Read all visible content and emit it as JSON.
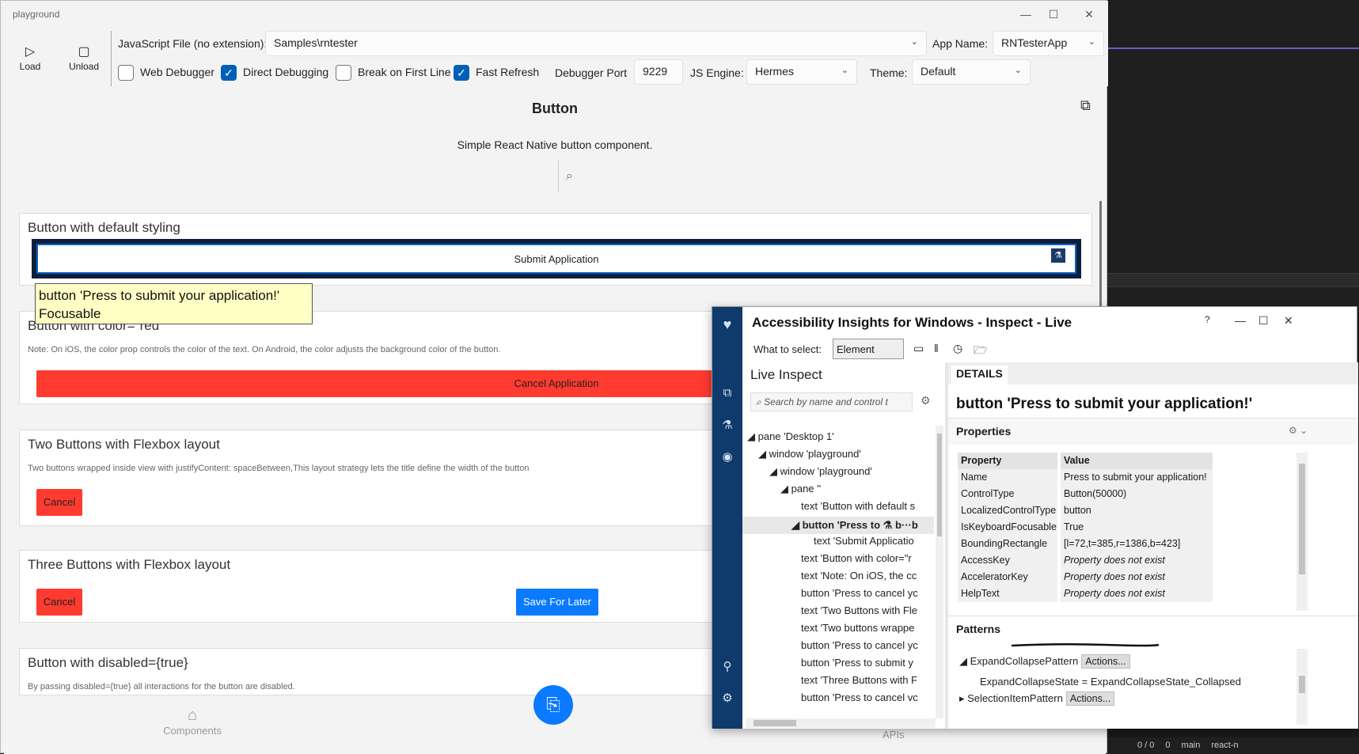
{
  "window": {
    "title": "playground",
    "controls": {
      "minimize": "—",
      "maximize": "☐",
      "close": "✕"
    }
  },
  "toolbar": {
    "load_label": "Load",
    "unload_label": "Unload",
    "js_file_label": "JavaScript File (no extension):",
    "js_file_value": "Samples\\rntester",
    "app_name_label": "App Name:",
    "app_name_value": "RNTesterApp",
    "web_debugger_label": "Web Debugger",
    "web_debugger_checked": false,
    "direct_debugging_label": "Direct Debugging",
    "direct_debugging_checked": true,
    "break_first_line_label": "Break on First Line",
    "break_first_line_checked": false,
    "fast_refresh_label": "Fast Refresh",
    "fast_refresh_checked": true,
    "debugger_port_label": "Debugger Port",
    "debugger_port_value": "9229",
    "js_engine_label": "JS Engine:",
    "js_engine_value": "Hermes",
    "theme_label": "Theme:",
    "theme_value": "Default"
  },
  "page": {
    "title": "Button",
    "description": "Simple React Native button component."
  },
  "cards": {
    "default": {
      "heading": "Button with default styling",
      "button": "Submit Application"
    },
    "color": {
      "heading": "Button with color=\"red\"",
      "note": "Note: On iOS, the color prop controls the color of the text. On Android, the color adjusts the background color of the button.",
      "button": "Cancel Application"
    },
    "two": {
      "heading": "Two Buttons with Flexbox layout",
      "note": "Two buttons wrapped inside view with justifyContent: spaceBetween,This layout strategy lets the title define the width of the button",
      "cancel": "Cancel"
    },
    "three": {
      "heading": "Three Buttons with Flexbox layout",
      "cancel": "Cancel",
      "save": "Save For Later"
    },
    "disabled": {
      "heading": "Button with disabled={true}",
      "note": "By passing disabled={true} all interactions for the button are disabled."
    }
  },
  "tooltip": {
    "line1": "button 'Press to submit your application!'",
    "line2": "Focusable"
  },
  "bottom_nav": {
    "components": "Components",
    "apis": "APIs"
  },
  "ai": {
    "title": "Accessibility Insights for Windows - Inspect - Live",
    "what_to_select_label": "What to select:",
    "what_to_select_value": "Element",
    "live_inspect": "Live Inspect",
    "search_placeholder": "Search by name and control t",
    "tree": [
      "pane 'Desktop 1'",
      "window 'playground'",
      "window 'playground'",
      "pane ''",
      "text 'Button with default s",
      "button 'Press to",
      "text 'Submit Applicatio",
      "text 'Button with color=\"r",
      "text 'Note: On iOS, the cc",
      "button 'Press to cancel yc",
      "text 'Two Buttons with Fle",
      "text 'Two buttons wrappe",
      "button 'Press to cancel yc",
      "button 'Press to submit y",
      "text 'Three Buttons with F",
      "button 'Press to cancel vc"
    ],
    "details_tab": "DETAILS",
    "details_heading": "button 'Press to submit your application!'",
    "properties_label": "Properties",
    "property_header": "Property",
    "value_header": "Value",
    "properties": [
      {
        "k": "Name",
        "v": "Press to submit your application!"
      },
      {
        "k": "ControlType",
        "v": "Button(50000)"
      },
      {
        "k": "LocalizedControlType",
        "v": "button"
      },
      {
        "k": "IsKeyboardFocusable",
        "v": "True"
      },
      {
        "k": "BoundingRectangle",
        "v": "[l=72,t=385,r=1386,b=423]"
      },
      {
        "k": "AccessKey",
        "v": "Property does not exist"
      },
      {
        "k": "AcceleratorKey",
        "v": "Property does not exist"
      },
      {
        "k": "HelpText",
        "v": "Property does not exist"
      }
    ],
    "patterns_label": "Patterns",
    "pattern1": "ExpandCollapsePattern",
    "actions_label": "Actions...",
    "pattern1_state": "ExpandCollapseState = ExpandCollapseState_Collapsed",
    "pattern2": "SelectionItemPattern"
  },
  "bg_status": {
    "branch": "main",
    "counts": "0 / 0",
    "pencil": "0",
    "repo": "react-n"
  },
  "colors": {
    "accent": "#005fb8",
    "red_button": "#ff3b30",
    "blue_button": "#0a7aff",
    "ai_rail": "#0e3b6b"
  }
}
